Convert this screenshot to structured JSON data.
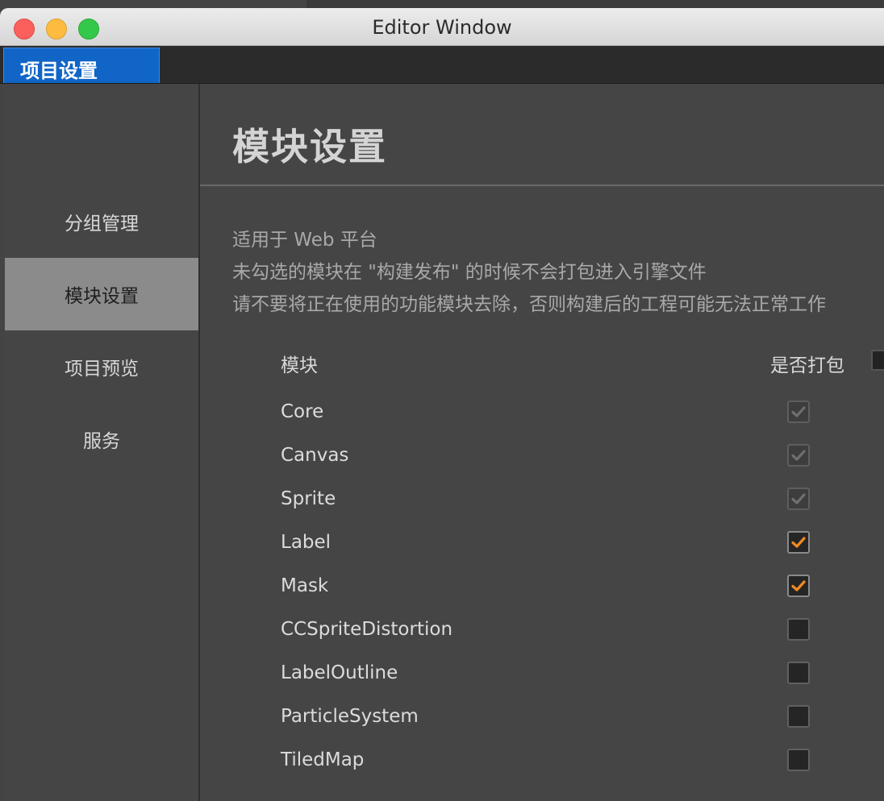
{
  "window": {
    "title": "Editor Window"
  },
  "tab": {
    "label": "项目设置"
  },
  "sidebar": {
    "items": [
      {
        "label": "分组管理",
        "active": false
      },
      {
        "label": "模块设置",
        "active": true
      },
      {
        "label": "项目预览",
        "active": false
      },
      {
        "label": "服务",
        "active": false
      }
    ]
  },
  "main": {
    "title": "模块设置",
    "description": [
      "适用于 Web 平台",
      "未勾选的模块在 \"构建发布\" 的时候不会打包进入引擎文件",
      "请不要将正在使用的功能模块去除，否则构建后的工程可能无法正常工作"
    ],
    "table": {
      "col_module": "模块",
      "col_include": "是否打包",
      "rows": [
        {
          "name": "Core",
          "state": "checked-disabled"
        },
        {
          "name": "Canvas",
          "state": "checked-disabled"
        },
        {
          "name": "Sprite",
          "state": "checked-disabled"
        },
        {
          "name": "Label",
          "state": "checked"
        },
        {
          "name": "Mask",
          "state": "checked"
        },
        {
          "name": "CCSpriteDistortion",
          "state": "unchecked"
        },
        {
          "name": "LabelOutline",
          "state": "unchecked"
        },
        {
          "name": "ParticleSystem",
          "state": "unchecked"
        },
        {
          "name": "TiledMap",
          "state": "unchecked"
        }
      ]
    }
  },
  "colors": {
    "accent_check": "#f08a24",
    "disabled_check": "#6e6e6e",
    "tab_active": "#1165c6",
    "sidebar_active": "#8b8b8b"
  }
}
